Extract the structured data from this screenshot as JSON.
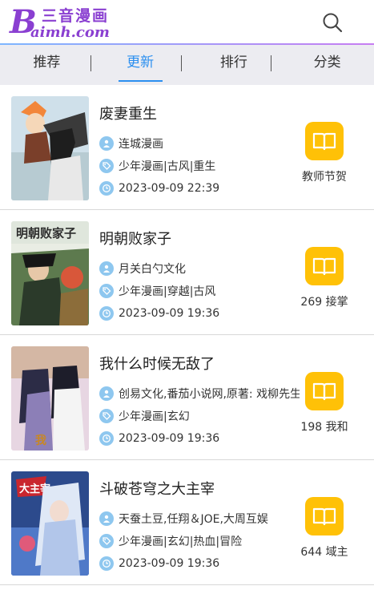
{
  "brand": {
    "logo_letter": "B",
    "logo_cn": "三音漫画",
    "logo_en": "aimh.com"
  },
  "tabs": [
    {
      "label": "推荐",
      "active": false
    },
    {
      "label": "更新",
      "active": true
    },
    {
      "label": "排行",
      "active": false
    },
    {
      "label": "分类",
      "active": false
    }
  ],
  "comics": [
    {
      "title": "废妻重生",
      "author": "连城漫画",
      "tags": "少年漫画|古风|重生",
      "updated": "2023-09-09 22:39",
      "latest_chapter": "教师节贺"
    },
    {
      "title": "明朝败家子",
      "author": "月关白勺文化",
      "tags": "少年漫画|穿越|古风",
      "updated": "2023-09-09 19:36",
      "latest_chapter": "269 接掌"
    },
    {
      "title": "我什么时候无敌了",
      "author": "创易文化,番茄小说网,原著: 戏柳先生",
      "tags": "少年漫画|玄幻",
      "updated": "2023-09-09 19:36",
      "latest_chapter": "198 我和"
    },
    {
      "title": "斗破苍穹之大主宰",
      "author": "天蚕土豆,任翔＆JOE,大周互娱",
      "tags": "少年漫画|玄幻|热血|冒险",
      "updated": "2023-09-09 19:36",
      "latest_chapter": "644 域主"
    }
  ],
  "colors": {
    "brand": "#8a3fd1",
    "accent": "#2b8ff0",
    "read_button": "#ffc107",
    "meta_icon": "#8ec7ef"
  },
  "icons": {
    "search": "search-icon",
    "author": "user-icon",
    "tags": "tag-icon",
    "time": "clock-icon",
    "read": "book-icon"
  }
}
